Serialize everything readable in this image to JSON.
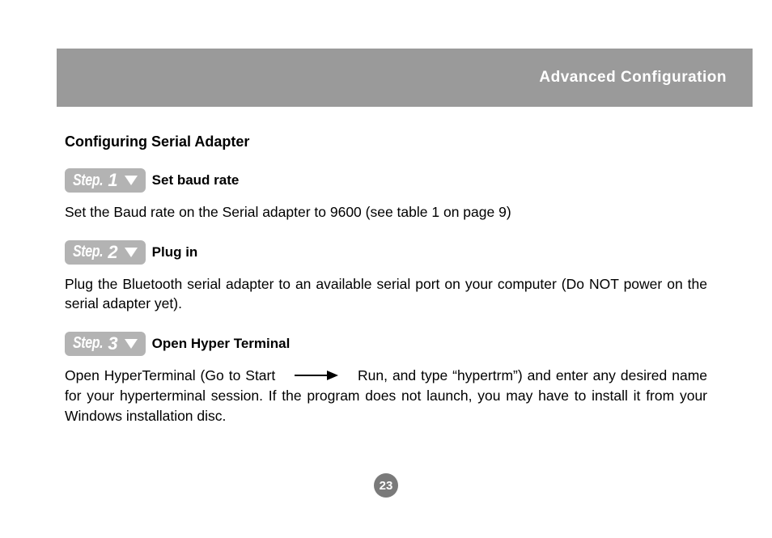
{
  "header": {
    "title": "Advanced Configuration"
  },
  "section_title": "Configuring Serial Adapter",
  "steps": [
    {
      "label": "Step.",
      "num": "1",
      "title": "Set baud rate",
      "body_pre": "Set the Baud rate on the Serial adapter to 9600 (see table 1 on page 9)",
      "body_post": ""
    },
    {
      "label": "Step.",
      "num": "2",
      "title": "Plug in",
      "body_pre": "Plug the Bluetooth serial adapter to an available serial port on your computer (Do NOT power on the serial adapter yet).",
      "body_post": ""
    },
    {
      "label": "Step.",
      "num": "3",
      "title": "Open Hyper Terminal",
      "body_pre": "Open HyperTerminal (Go to Start",
      "body_post": "Run, and type “hypertrm”) and enter any desired name for your hyperterminal session. If the program does not launch, you may have to install it from your Windows installation disc."
    }
  ],
  "page_number": "23"
}
